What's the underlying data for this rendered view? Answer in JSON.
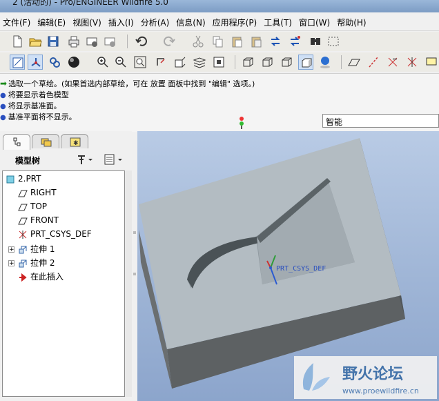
{
  "window": {
    "title": "2 (活动的) - Pro/ENGINEER Wildfire 5.0"
  },
  "menu": [
    "文件(F)",
    "编辑(E)",
    "视图(V)",
    "插入(I)",
    "分析(A)",
    "信息(N)",
    "应用程序(P)",
    "工具(T)",
    "窗口(W)",
    "帮助(H)"
  ],
  "messages": [
    "选取一个草绘。(如果首选内部草绘，可在 放置 面板中找到 \"编辑\" 选项。)",
    "将要显示着色模型",
    "将显示基准面。",
    "基准平面将不显示。"
  ],
  "filter": {
    "value": "智能"
  },
  "model_tree": {
    "title": "模型树",
    "items": [
      {
        "label": "2.PRT",
        "icon": "part-icon"
      },
      {
        "label": "RIGHT",
        "icon": "datum-plane-icon"
      },
      {
        "label": "TOP",
        "icon": "datum-plane-icon"
      },
      {
        "label": "FRONT",
        "icon": "datum-plane-icon"
      },
      {
        "label": "PRT_CSYS_DEF",
        "icon": "coordinate-system-icon"
      },
      {
        "label": "拉伸 1",
        "icon": "extrude-icon"
      },
      {
        "label": "拉伸 2",
        "icon": "extrude-icon"
      },
      {
        "label": "在此插入",
        "icon": "insert-here-arrow-icon"
      }
    ]
  },
  "viewport": {
    "csys_label": "PRT_CSYS_DEF"
  },
  "watermark": {
    "title": "野火论坛",
    "url": "www.proewildfire.cn"
  },
  "colors": {
    "model_face": "#b3bcc2",
    "model_side": "#5a5e60",
    "viewport_top": "#b9cbe5",
    "viewport_bottom": "#8ca5cc"
  }
}
